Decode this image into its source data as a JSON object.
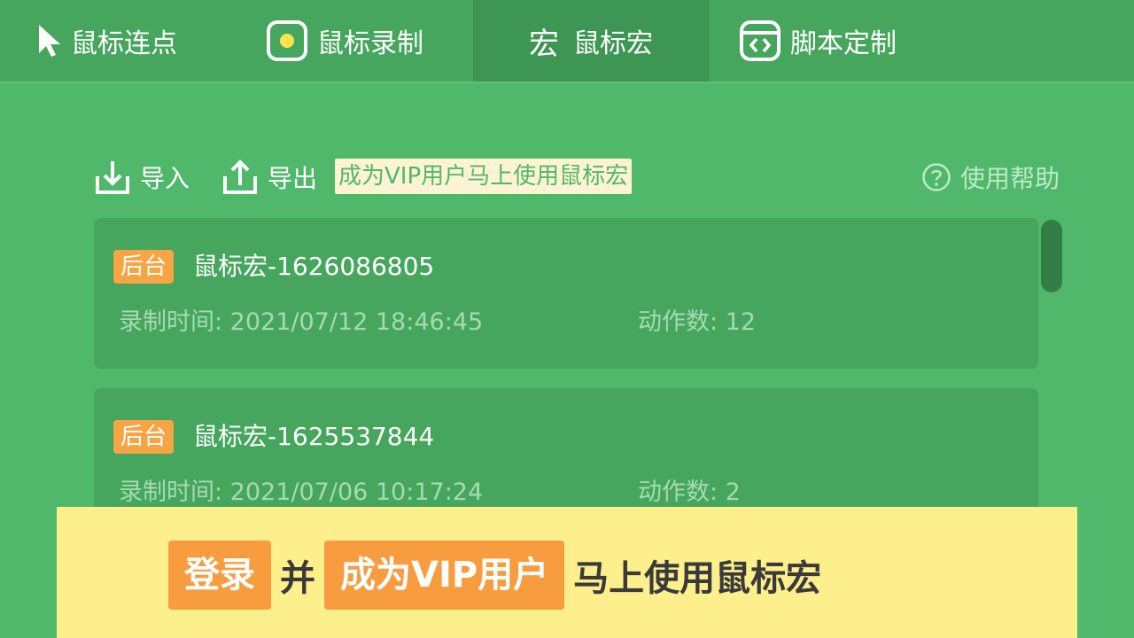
{
  "tabs": [
    {
      "label": "鼠标连点",
      "icon": "cursor-icon"
    },
    {
      "label": "鼠标录制",
      "icon": "record-icon"
    },
    {
      "label": "鼠标宏",
      "icon": "macro-icon",
      "glyph": "宏",
      "active": true
    },
    {
      "label": "脚本定制",
      "icon": "code-window-icon"
    }
  ],
  "toolbar": {
    "import_label": "导入",
    "export_label": "导出",
    "vip_hint": "成为VIP用户马上使用鼠标宏",
    "help_label": "使用帮助"
  },
  "macros": [
    {
      "badge": "后台",
      "title": "鼠标宏-1626086805",
      "record_time": "录制时间: 2021/07/12 18:46:45",
      "actions": "动作数: 12"
    },
    {
      "badge": "后台",
      "title": "鼠标宏-1625537844",
      "record_time": "录制时间: 2021/07/06 10:17:24",
      "actions": "动作数: 2"
    }
  ],
  "banner": {
    "login_label": "登录",
    "and_text": "并",
    "vip_label": "成为VIP用户",
    "tail_text": "马上使用鼠标宏"
  },
  "colors": {
    "background": "#4fb86b",
    "tabbar": "#46a65d",
    "active_tab": "#3d9653",
    "badge": "#f7a445",
    "banner": "#fdef8c",
    "banner_button": "#f79c3f"
  }
}
